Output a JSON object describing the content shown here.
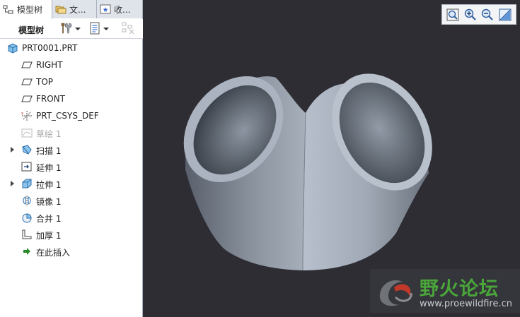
{
  "tabs": {
    "model_tree": "模型树",
    "files": "文...",
    "favorites": "收..."
  },
  "panel": {
    "title": "模型树"
  },
  "tree": {
    "root": "PRT0001.PRT",
    "items": [
      {
        "label": "RIGHT",
        "icon": "datum-plane-icon",
        "expandable": false,
        "disabled": false
      },
      {
        "label": "TOP",
        "icon": "datum-plane-icon",
        "expandable": false,
        "disabled": false
      },
      {
        "label": "FRONT",
        "icon": "datum-plane-icon",
        "expandable": false,
        "disabled": false
      },
      {
        "label": "PRT_CSYS_DEF",
        "icon": "coordinate-system-icon",
        "expandable": false,
        "disabled": false
      },
      {
        "label": "草绘 1",
        "icon": "sketch-icon",
        "expandable": false,
        "disabled": true
      },
      {
        "label": "扫描 1",
        "icon": "sweep-icon",
        "expandable": true,
        "disabled": false
      },
      {
        "label": "延伸 1",
        "icon": "extend-icon",
        "expandable": false,
        "disabled": false
      },
      {
        "label": "拉伸 1",
        "icon": "extrude-icon",
        "expandable": true,
        "disabled": false
      },
      {
        "label": "镜像 1",
        "icon": "mirror-icon",
        "expandable": false,
        "disabled": false
      },
      {
        "label": "合并 1",
        "icon": "merge-icon",
        "expandable": false,
        "disabled": false
      },
      {
        "label": "加厚 1",
        "icon": "thicken-icon",
        "expandable": false,
        "disabled": false
      },
      {
        "label": "在此插入",
        "icon": "insert-here-icon",
        "expandable": false,
        "disabled": false
      }
    ]
  },
  "view_toolbar": {
    "buttons": [
      "refit-icon",
      "zoom-in-icon",
      "zoom-out-icon",
      "repaint-icon"
    ]
  },
  "watermark": {
    "title": "野火论坛",
    "url": "www.proewildfire.cn"
  },
  "colors": {
    "viewport_bg": "#2d2d33",
    "model_color": "#aab3bf",
    "watermark_green": "#4aa63a"
  }
}
